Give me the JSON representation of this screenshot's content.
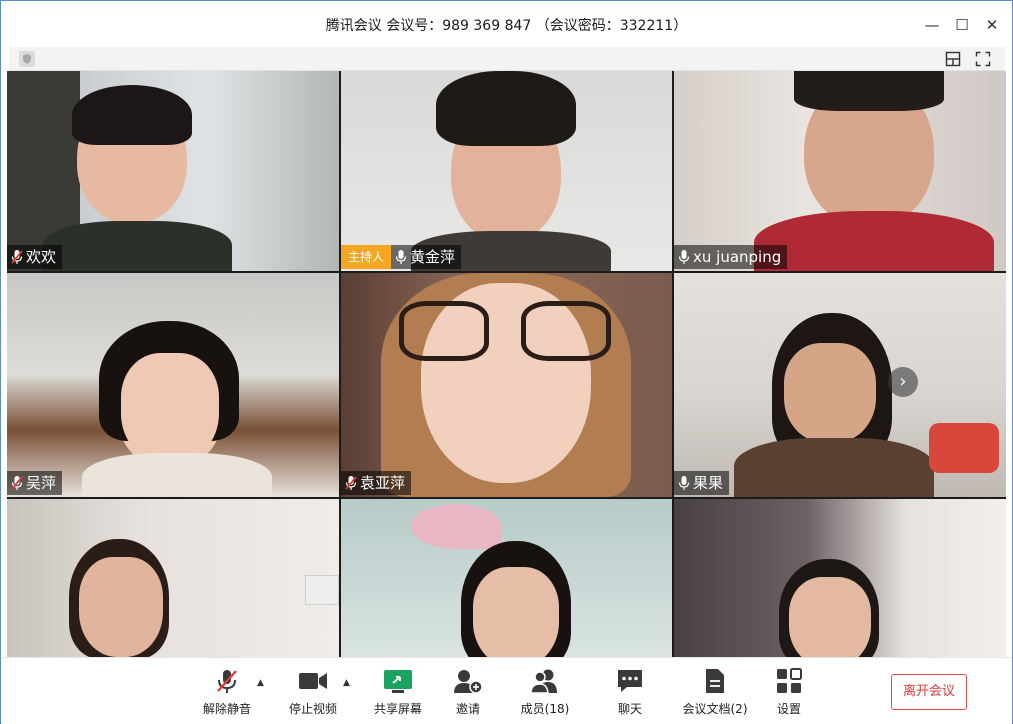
{
  "window": {
    "title": "腾讯会议 会议号：989 369 847 （会议密码：332211）",
    "minimize_glyph": "—",
    "maximize_glyph": "☐",
    "close_glyph": "✕"
  },
  "participants": [
    {
      "name": "欢欢",
      "mic": "muted",
      "host": false
    },
    {
      "name": "黄金萍",
      "mic": "on",
      "host": true,
      "host_label": "主持人"
    },
    {
      "name": "xu juanping",
      "mic": "on",
      "host": false
    },
    {
      "name": "吴萍",
      "mic": "muted",
      "host": false
    },
    {
      "name": "袁亚萍",
      "mic": "muted",
      "host": false
    },
    {
      "name": "果果",
      "mic": "on",
      "host": false
    },
    {
      "name": "",
      "mic": "",
      "host": false
    },
    {
      "name": "",
      "mic": "",
      "host": false
    },
    {
      "name": "",
      "mic": "",
      "host": false
    }
  ],
  "grid": {
    "next_page_glyph": "›"
  },
  "toolbar": {
    "unmute": "解除静音",
    "stop_video": "停止视频",
    "share_screen": "共享屏幕",
    "invite": "邀请",
    "members": "成员(18)",
    "chat": "聊天",
    "documents": "会议文档(2)",
    "settings": "设置",
    "leave": "离开会议",
    "caret_glyph": "▲"
  },
  "colors": {
    "accent_green": "#1aa260",
    "host_badge": "#f5a623",
    "leave_red": "#d93a3a",
    "muted_red": "#e03c3c"
  }
}
